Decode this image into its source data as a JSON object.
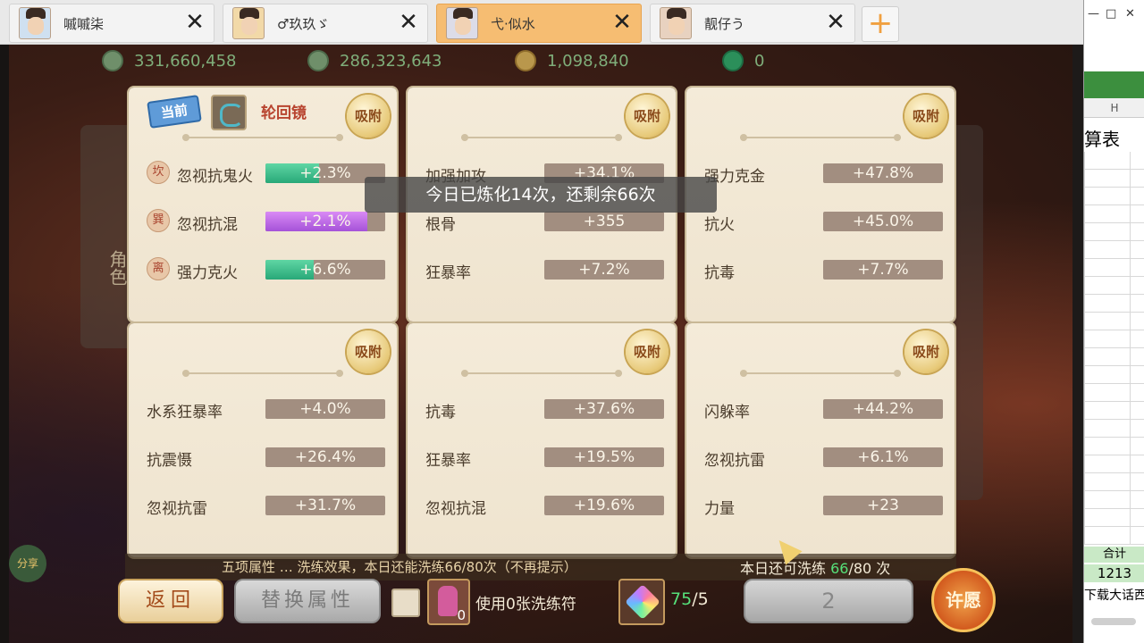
{
  "tabs": [
    {
      "label": "嘁嘁柒",
      "active": false
    },
    {
      "label": "♂玖玖ゞ",
      "active": false
    },
    {
      "label": "弋·似水",
      "active": true
    },
    {
      "label": "靓仔う",
      "active": false
    }
  ],
  "add_tab_symbol": "+",
  "close_symbol": "✕",
  "currencies": [
    {
      "value": "331,660,458",
      "icon": "silver-icon"
    },
    {
      "value": "286,323,643",
      "icon": "silver2-icon"
    },
    {
      "value": "1,098,840",
      "icon": "coin-icon"
    },
    {
      "value": "0",
      "icon": "jade-icon"
    }
  ],
  "side_tab_label": "角色",
  "absorb_label": "吸附",
  "current_badge": "当前",
  "first_card_title": "轮回镜",
  "cards": [
    {
      "rows": [
        {
          "elem": "坎",
          "name": "忽视抗鬼火",
          "value": "+2.3%",
          "fill": 0.45,
          "fill_color": "green"
        },
        {
          "elem": "巽",
          "name": "忽视抗混",
          "value": "+2.1%",
          "fill": 0.85,
          "fill_color": "purple"
        },
        {
          "elem": "离",
          "name": "强力克火",
          "value": "+6.6%",
          "fill": 0.4,
          "fill_color": "green"
        }
      ]
    },
    {
      "rows": [
        {
          "name": "加强加攻",
          "value": "+34.1%"
        },
        {
          "name": "根骨",
          "value": "+355"
        },
        {
          "name": "狂暴率",
          "value": "+7.2%"
        }
      ]
    },
    {
      "rows": [
        {
          "name": "强力克金",
          "value": "+47.8%"
        },
        {
          "name": "抗火",
          "value": "+45.0%"
        },
        {
          "name": "抗毒",
          "value": "+7.7%"
        }
      ]
    },
    {
      "rows": [
        {
          "name": "水系狂暴率",
          "value": "+4.0%"
        },
        {
          "name": "抗震慑",
          "value": "+26.4%"
        },
        {
          "name": "忽视抗雷",
          "value": "+31.7%"
        }
      ]
    },
    {
      "rows": [
        {
          "name": "抗毒",
          "value": "+37.6%"
        },
        {
          "name": "狂暴率",
          "value": "+19.5%"
        },
        {
          "name": "忽视抗混",
          "value": "+19.6%"
        }
      ]
    },
    {
      "rows": [
        {
          "name": "闪躲率",
          "value": "+44.2%"
        },
        {
          "name": "忽视抗雷",
          "value": "+6.1%"
        },
        {
          "name": "力量",
          "value": "+23"
        }
      ]
    }
  ],
  "toast": "今日已炼化14次，还剩余66次",
  "bottom_tip": "五项属性 … 洗练效果，本日还能洗练66/80次（不再提示）",
  "remaining": {
    "prefix": "本日还可洗练 ",
    "count": "66",
    "suffix": "/80 次"
  },
  "share_label": "分享",
  "buttons": {
    "back": "返回",
    "replace": "替换属性",
    "num": "2",
    "wish": "许愿"
  },
  "charm_count": "0",
  "use_text": "使用0张洗练符",
  "gem": {
    "have": "75",
    "need": "/5"
  },
  "sheet": {
    "col": "H",
    "title": "算表",
    "sum_label": "合计",
    "sum_value": "1213",
    "footer": "下载大话西",
    "min": "—",
    "max": "□",
    "close": "✕"
  }
}
